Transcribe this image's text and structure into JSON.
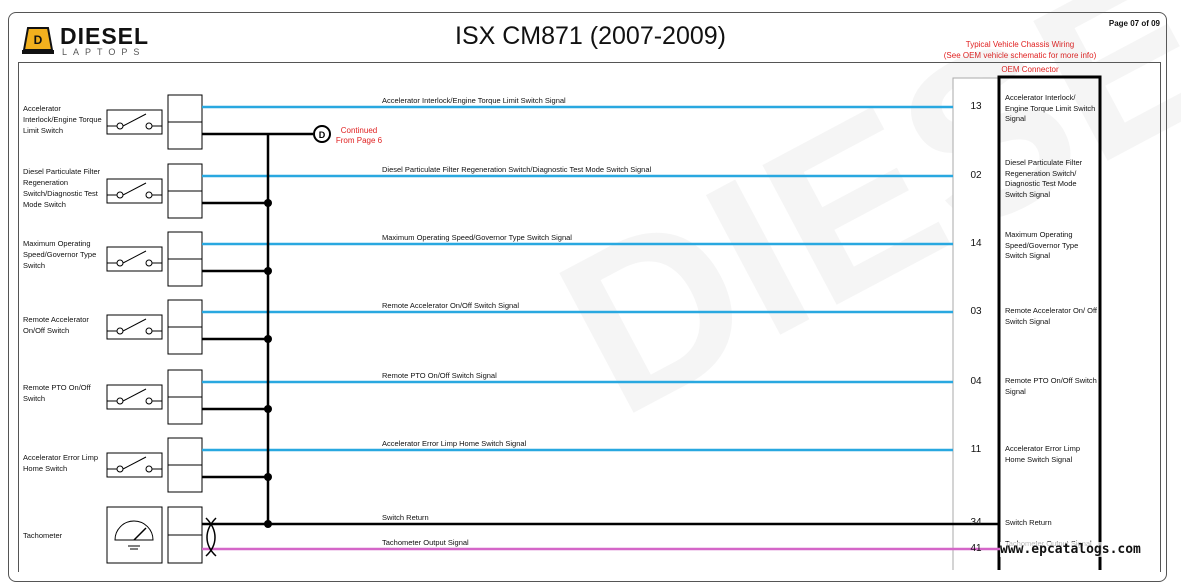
{
  "header": {
    "title": "ISX CM871 (2007-2009)",
    "page": "Page 07 of 09",
    "logo_word": "DIESEL",
    "logo_sub": "LAPTOPS",
    "chassis_note_1": "Typical Vehicle Chassis Wiring",
    "chassis_note_2": "(See OEM vehicle schematic for more info)",
    "oem_connector": "OEM Connector"
  },
  "continued": {
    "letter": "D",
    "line1": "Continued",
    "line2": "From Page 6"
  },
  "colors": {
    "signal_wire": "#29a8e0",
    "ground_wire": "#000000",
    "tach_wire": "#d466c8",
    "note_red": "#e02020"
  },
  "switches": [
    {
      "label": "Accelerator Interlock/Engine Torque Limit Switch",
      "signal": "Accelerator Interlock/Engine Torque Limit Switch Signal",
      "pin": "13",
      "oem_label": "Accelerator Interlock/ Engine Torque Limit Switch Signal"
    },
    {
      "label": "Diesel Particulate Filter Regeneration Switch/Diagnostic Test Mode Switch",
      "signal": "Diesel Particulate Filter Regeneration Switch/Diagnostic Test Mode Switch Signal",
      "pin": "02",
      "oem_label": "Diesel Particulate Filter Regeneration Switch/ Diagnostic Test Mode Switch Signal"
    },
    {
      "label": "Maximum Operating Speed/Governor Type Switch",
      "signal": "Maximum Operating Speed/Governor Type Switch Signal",
      "pin": "14",
      "oem_label": "Maximum Operating Speed/Governor Type Switch Signal"
    },
    {
      "label": "Remote Accelerator On/Off Switch",
      "signal": "Remote Accelerator On/Off Switch Signal",
      "pin": "03",
      "oem_label": "Remote Accelerator On/ Off Switch Signal"
    },
    {
      "label": "Remote PTO On/Off Switch",
      "signal": "Remote PTO On/Off Switch Signal",
      "pin": "04",
      "oem_label": "Remote PTO On/Off Switch Signal"
    },
    {
      "label": "Accelerator Error Limp Home Switch",
      "signal": "Accelerator Error Limp Home Switch Signal",
      "pin": "11",
      "oem_label": "Accelerator Error Limp Home Switch Signal"
    }
  ],
  "tachometer": {
    "label": "Tachometer",
    "return_signal": "Switch Return",
    "return_pin": "34",
    "return_oem_label": "Switch Return",
    "output_signal": "Tachometer Output Signal",
    "output_pin": "41",
    "output_oem_label": "Tachometer Output Signal"
  },
  "watermark": "www.epcatalogs.com"
}
